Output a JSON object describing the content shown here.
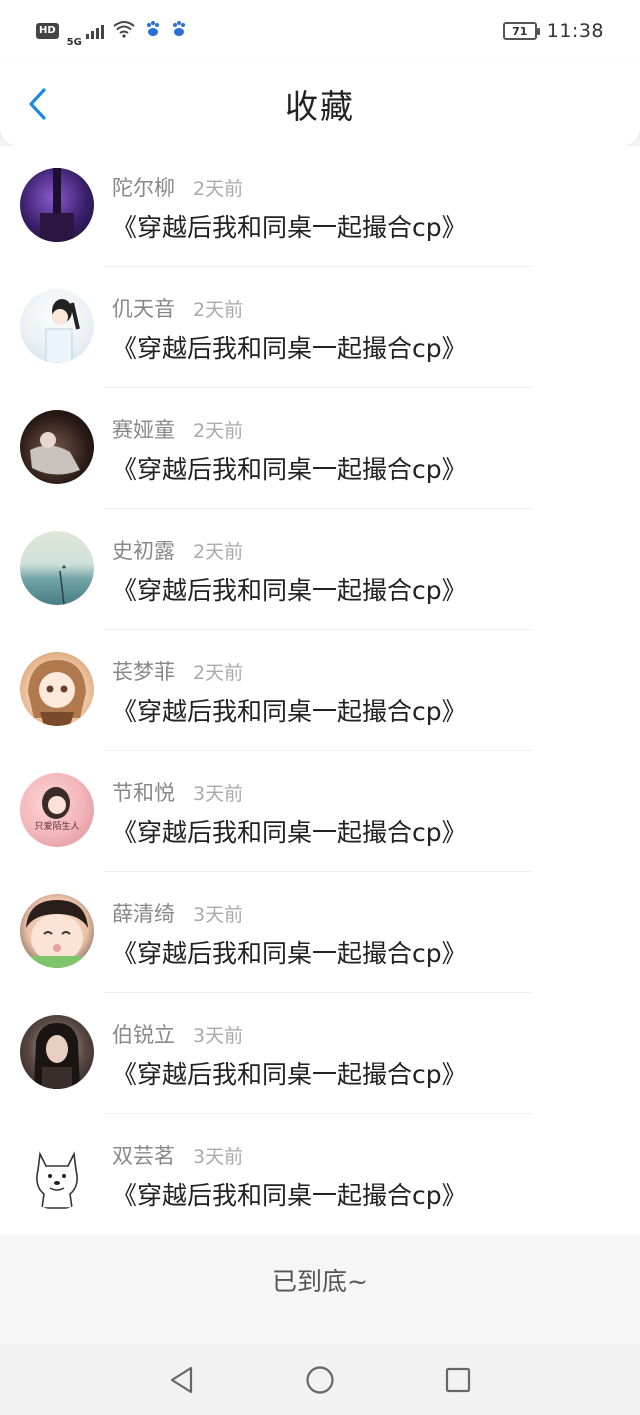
{
  "status_bar": {
    "hd": "HD",
    "network": "5G",
    "battery": "71",
    "time": "11:38",
    "icons": [
      "signal-icon",
      "wifi-icon",
      "baidu-paw-icon",
      "baidu-paw-icon"
    ]
  },
  "header": {
    "title": "收藏",
    "back_icon": "chevron-left-icon",
    "accent": "#1e88e5"
  },
  "favorites": [
    {
      "name": "陀尔柳",
      "time": "2天前",
      "book": "《穿越后我和同桌一起撮合cp》"
    },
    {
      "name": "仉天音",
      "time": "2天前",
      "book": "《穿越后我和同桌一起撮合cp》"
    },
    {
      "name": "赛娅童",
      "time": "2天前",
      "book": "《穿越后我和同桌一起撮合cp》"
    },
    {
      "name": "史初露",
      "time": "2天前",
      "book": "《穿越后我和同桌一起撮合cp》"
    },
    {
      "name": "苌梦菲",
      "time": "2天前",
      "book": "《穿越后我和同桌一起撮合cp》"
    },
    {
      "name": "节和悦",
      "time": "3天前",
      "book": "《穿越后我和同桌一起撮合cp》",
      "avatar_caption": "只爱陌生人"
    },
    {
      "name": "薛清绮",
      "time": "3天前",
      "book": "《穿越后我和同桌一起撮合cp》"
    },
    {
      "name": "伯锐立",
      "time": "3天前",
      "book": "《穿越后我和同桌一起撮合cp》"
    },
    {
      "name": "双芸茗",
      "time": "3天前",
      "book": "《穿越后我和同桌一起撮合cp》"
    }
  ],
  "footer": {
    "end_text": "已到底~"
  },
  "nav": {
    "back": "triangle-back-icon",
    "home": "circle-home-icon",
    "recents": "square-recents-icon"
  }
}
